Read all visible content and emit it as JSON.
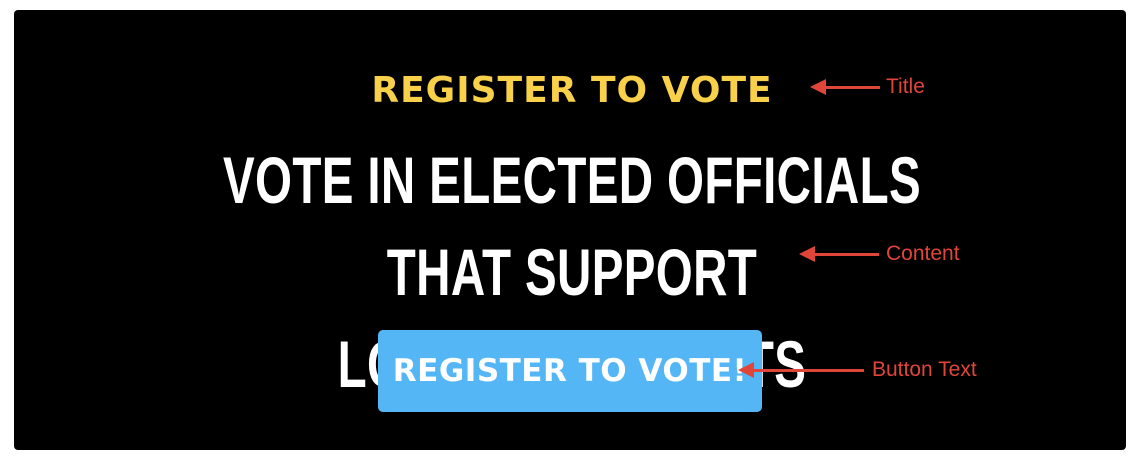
{
  "banner": {
    "title": "REGISTER TO VOTE",
    "content_line1": "VOTE IN ELECTED OFFICIALS THAT SUPPORT",
    "content_line2": "LGBTQ+ STUDENTS",
    "button_label": "REGISTER TO VOTE!"
  },
  "annotations": {
    "title_label": "Title",
    "content_label": "Content",
    "button_text_label": "Button Text"
  },
  "colors": {
    "background": "#000000",
    "title": "#f9d04a",
    "content": "#ffffff",
    "button": "#55b6f6",
    "annotation": "#e0453a"
  }
}
